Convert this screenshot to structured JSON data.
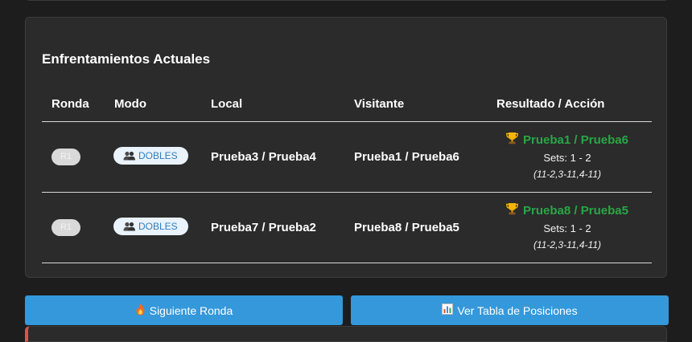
{
  "section_title": "Enfrentamientos Actuales",
  "columns": {
    "round": "Ronda",
    "mode": "Modo",
    "home": "Local",
    "away": "Visitante",
    "result": "Resultado / Acción"
  },
  "matches": [
    {
      "round": "R1",
      "mode": "DOBLES",
      "home": "Prueba3 / Prueba4",
      "away": "Prueba1 / Prueba6",
      "winner": "Prueba1 / Prueba6",
      "sets": "Sets: 1 - 2",
      "detail": "(11-2,3-11,4-11)"
    },
    {
      "round": "R1",
      "mode": "DOBLES",
      "home": "Prueba7 / Prueba2",
      "away": "Prueba8 / Prueba5",
      "winner": "Prueba8 / Prueba5",
      "sets": "Sets: 1 - 2",
      "detail": "(11-2,3-11,4-11)"
    }
  ],
  "actions": {
    "next_round": "Siguiente Ronda",
    "next_round_icon": "fire-icon",
    "standings": "Ver Tabla de Posiciones",
    "standings_icon": "bar-chart-icon"
  },
  "colors": {
    "accent": "#3498db",
    "winner": "#28a745",
    "card_bg": "#2b2b2b",
    "page_bg": "#1d1d1d",
    "alert_border": "#d9534f"
  }
}
